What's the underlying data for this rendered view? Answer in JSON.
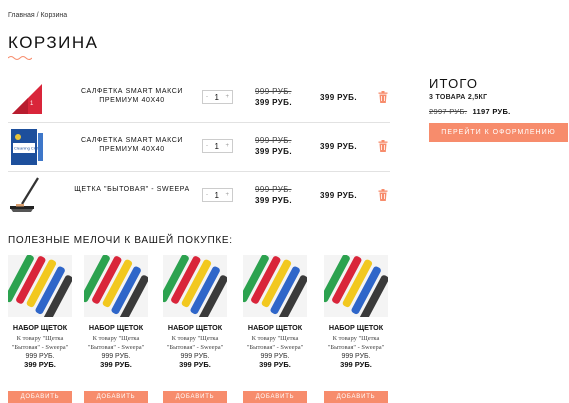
{
  "breadcrumb": "Главная / Корзина",
  "page_title": "КОРЗИНА",
  "colors": {
    "accent": "#f78c6c",
    "divider": "#e2e2e2"
  },
  "cart": {
    "items": [
      {
        "name": "САЛФЕТКА SMART МАКСИ ПРЕМИУМ 40Х40",
        "qty": "1",
        "old_price": "999 РУБ.",
        "new_price": "399 РУБ.",
        "total": "399 РУБ.",
        "thumb_label": "1"
      },
      {
        "name": "САЛФЕТКА SMART МАКСИ ПРЕМИУМ 40Х40",
        "qty": "1",
        "old_price": "999 РУБ.",
        "new_price": "399 РУБ.",
        "total": "399 РУБ.",
        "thumb_label": "Cleaning Cloth"
      },
      {
        "name": "ЩЕТКА \"БЫТОВАЯ\" - SWEEPA",
        "qty": "1",
        "old_price": "999 РУБ.",
        "new_price": "399 РУБ.",
        "total": "399 РУБ."
      }
    ],
    "qty_minus": "-",
    "qty_plus": "+"
  },
  "summary": {
    "title": "ИТОГО",
    "meta": "3 ТОВАРА 2,5КГ",
    "old_total": "2997 РУБ.",
    "new_total": "1197 РУБ.",
    "checkout_label": "ПЕРЕЙТИ К ОФОРМЛЕНИЮ"
  },
  "upsell": {
    "title": "ПОЛЕЗНЫЕ МЕЛОЧИ К ВАШЕЙ ПОКУПКЕ:",
    "products": [
      {
        "name": "НАБОР ЩЕТОК",
        "desc": "К товару \"Щетка \"Бытовая\" - Sweepa\"",
        "old_price": "999 РУБ.",
        "new_price": "399 РУБ.",
        "button": "ДОБАВИТЬ"
      },
      {
        "name": "НАБОР ЩЕТОК",
        "desc": "К товару \"Щетка \"Бытовая\" - Sweepa\"",
        "old_price": "999 РУБ.",
        "new_price": "399 РУБ.",
        "button": "ДОБАВИТЬ"
      },
      {
        "name": "НАБОР ЩЕТОК",
        "desc": "К товару \"Щетка \"Бытовая\" - Sweepa\"",
        "old_price": "999 РУБ.",
        "new_price": "399 РУБ.",
        "button": "ДОБАВИТЬ"
      },
      {
        "name": "НАБОР ЩЕТОК",
        "desc": "К товару \"Щетка \"Бытовая\" - Sweepa\"",
        "old_price": "999 РУБ.",
        "new_price": "399 РУБ.",
        "button": "ДОБАВИТЬ"
      },
      {
        "name": "НАБОР ЩЕТОК",
        "desc": "К товару \"Щетка \"Бытовая\" - Sweepa\"",
        "old_price": "999 РУБ.",
        "new_price": "399 РУБ.",
        "button": "ДОБАВИТЬ"
      }
    ]
  }
}
